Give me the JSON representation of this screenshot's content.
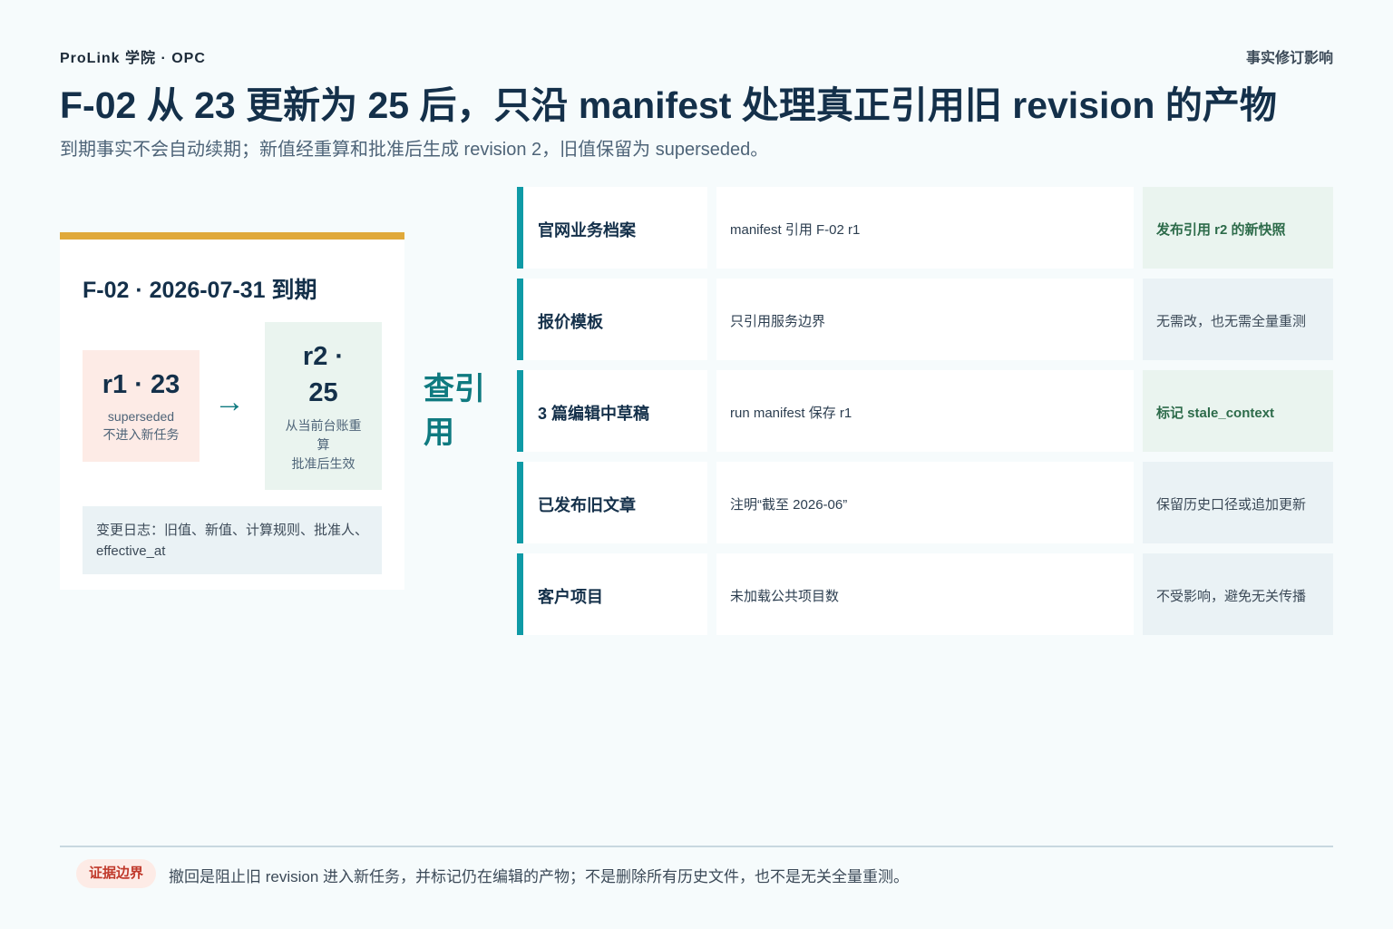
{
  "header": {
    "brand": "ProLink 学院 · OPC",
    "topic": "事实修订影响",
    "title": "F-02 从 23 更新为 25 后，只沿 manifest 处理真正引用旧 revision 的产物",
    "subtitle": "到期事实不会自动续期；新值经重算和批准后生成 revision 2，旧值保留为 superseded。"
  },
  "fact_card": {
    "title": "F-02 · 2026-07-31 到期",
    "old_revision": {
      "label": "r1 · 23",
      "status": "superseded",
      "note": "不进入新任务"
    },
    "arrow": "→",
    "new_revision": {
      "label_line1": "r2 ·",
      "label_line2": "25",
      "note_line1": "从当前台账重",
      "note_line2": "算",
      "note_line3": "批准后生效"
    },
    "changelog": "变更日志：旧值、新值、计算规则、批准人、effective_at",
    "accent_color": "#e0a93a"
  },
  "lookup_label": {
    "line1": "查引",
    "line2": "用"
  },
  "impact_rows": [
    {
      "artifact": "官网业务档案",
      "reference": "manifest 引用 F-02 r1",
      "action": "发布引用 r2 的新快照",
      "highlight": true
    },
    {
      "artifact": "报价模板",
      "reference": "只引用服务边界",
      "action": "无需改，也无需全量重测",
      "highlight": false
    },
    {
      "artifact": "3 篇编辑中草稿",
      "reference": "run manifest 保存 r1",
      "action": "标记 stale_context",
      "highlight": true
    },
    {
      "artifact": "已发布旧文章",
      "reference": "注明“截至 2026-06”",
      "action": "保留历史口径或追加更新",
      "highlight": false
    },
    {
      "artifact": "客户项目",
      "reference": "未加载公共项目数",
      "action": "不受影响，避免无关传播",
      "highlight": false
    }
  ],
  "footer": {
    "badge": "证据边界",
    "text": "撤回是阻止旧 revision 进入新任务，并标记仍在编辑的产物；不是删除所有历史文件，也不是无关全量重测。"
  },
  "colors": {
    "teal": "#0f9aa6",
    "positive": "#2d6b4a",
    "warning_bg": "#fdebe6"
  }
}
